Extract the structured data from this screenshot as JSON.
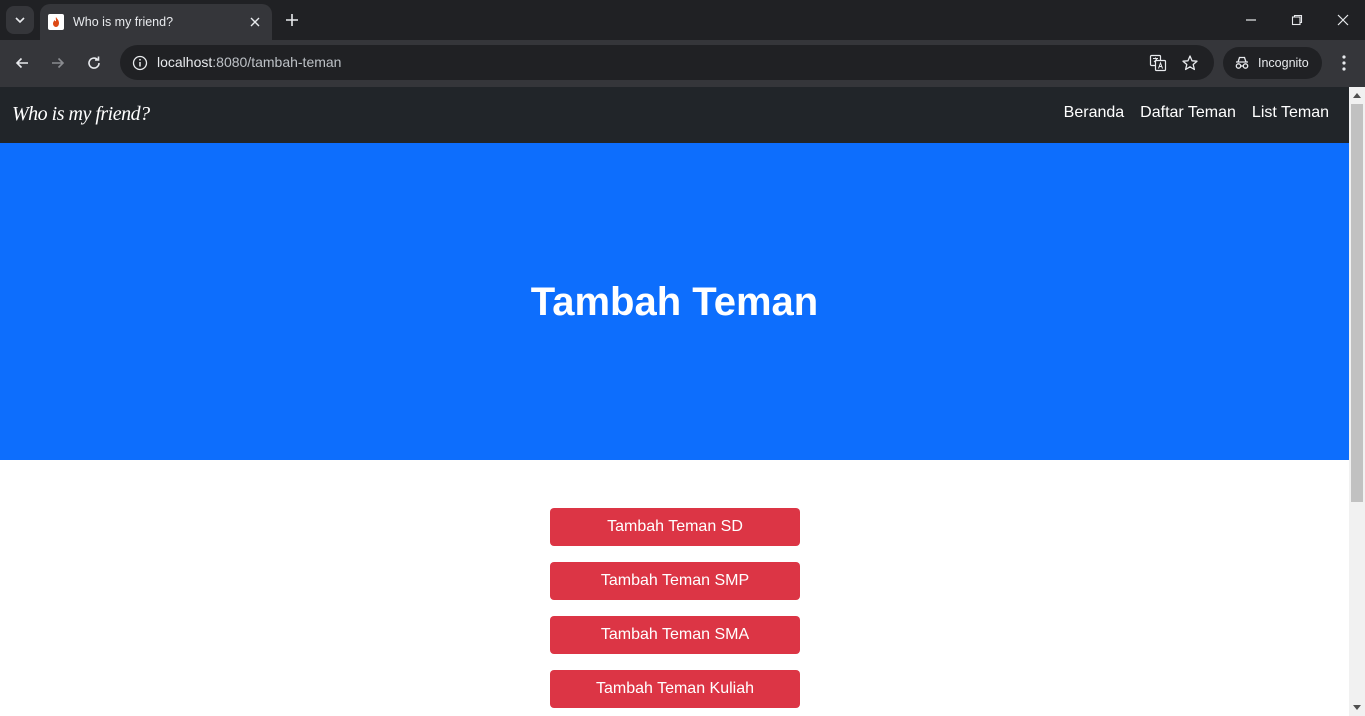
{
  "browser": {
    "tab_title": "Who is my friend?",
    "url_host": "localhost",
    "url_path": ":8080/tambah-teman",
    "incognito_label": "Incognito"
  },
  "site": {
    "brand": "Who is my friend?",
    "nav": [
      {
        "label": "Beranda"
      },
      {
        "label": "Daftar Teman"
      },
      {
        "label": "List Teman"
      }
    ]
  },
  "hero": {
    "title": "Tambah Teman"
  },
  "buttons": [
    {
      "label": "Tambah Teman SD"
    },
    {
      "label": "Tambah Teman SMP"
    },
    {
      "label": "Tambah Teman SMA"
    },
    {
      "label": "Tambah Teman Kuliah"
    }
  ],
  "colors": {
    "navbar": "#212529",
    "hero": "#0d6efd",
    "button": "#dc3545"
  }
}
